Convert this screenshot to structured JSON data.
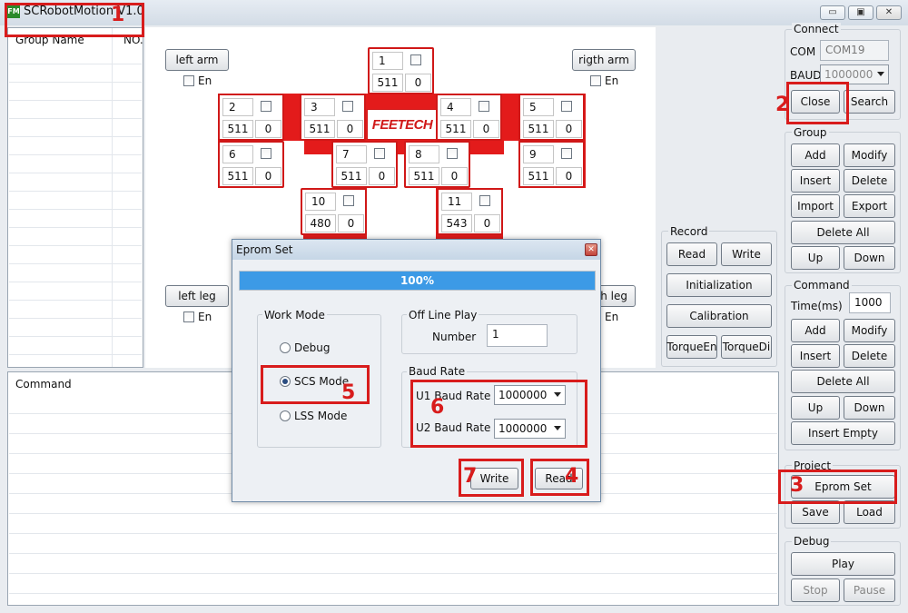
{
  "window": {
    "title": "SCRobotMotion V1.0",
    "icon_text": "FM",
    "controls": {
      "minimize": "▭",
      "restore": "▣",
      "close": "✕"
    }
  },
  "group_list": {
    "col_group_name": "Group Name",
    "col_no": "NO."
  },
  "robot": {
    "left_arm_label": "left arm",
    "right_arm_label": "rigth arm",
    "left_leg_label": "left leg",
    "right_leg_label": "h leg",
    "en_label": "En",
    "logo_text": "FEETECH",
    "servos": [
      {
        "id": "1",
        "position": "511",
        "speed": "0"
      },
      {
        "id": "2",
        "position": "511",
        "speed": "0"
      },
      {
        "id": "3",
        "position": "511",
        "speed": "0"
      },
      {
        "id": "4",
        "position": "511",
        "speed": "0"
      },
      {
        "id": "5",
        "position": "511",
        "speed": "0"
      },
      {
        "id": "6",
        "position": "511",
        "speed": "0"
      },
      {
        "id": "7",
        "position": "511",
        "speed": "0"
      },
      {
        "id": "8",
        "position": "511",
        "speed": "0"
      },
      {
        "id": "9",
        "position": "511",
        "speed": "0"
      },
      {
        "id": "10",
        "position": "480",
        "speed": "0"
      },
      {
        "id": "11",
        "position": "543",
        "speed": "0"
      }
    ]
  },
  "record": {
    "title": "Record",
    "read": "Read",
    "write": "Write",
    "initialization": "Initialization",
    "calibration": "Calibration",
    "torque_en": "TorqueEn",
    "torque_di": "TorqueDi"
  },
  "command_panel": {
    "header": "Command"
  },
  "connect": {
    "title": "Connect",
    "com_label": "COM",
    "com_value": "COM19",
    "baud_label": "BAUD",
    "baud_value": "1000000",
    "close": "Close",
    "search": "Search"
  },
  "group": {
    "title": "Group",
    "add": "Add",
    "modify": "Modify",
    "insert": "Insert",
    "delete": "Delete",
    "import": "Import",
    "export": "Export",
    "delete_all": "Delete All",
    "up": "Up",
    "down": "Down"
  },
  "command": {
    "title": "Command",
    "time_label": "Time(ms)",
    "time_value": "1000",
    "add": "Add",
    "modify": "Modify",
    "insert": "Insert",
    "delete": "Delete",
    "delete_all": "Delete All",
    "up": "Up",
    "down": "Down",
    "insert_empty": "Insert Empty"
  },
  "project": {
    "title": "Project",
    "eprom_set": "Eprom Set",
    "save": "Save",
    "load": "Load"
  },
  "debug": {
    "title": "Debug",
    "play": "Play",
    "stop": "Stop",
    "pause": "Pause"
  },
  "dialog": {
    "title": "Eprom Set",
    "progress_text": "100%",
    "progress_value": 1.0,
    "work_mode_title": "Work Mode",
    "mode_debug": "Debug",
    "mode_scs": "SCS Mode",
    "mode_lss": "LSS Mode",
    "selected_mode": "scs",
    "offline_title": "Off Line Play",
    "number_label": "Number",
    "number_value": "1",
    "baud_title": "Baud Rate",
    "u1_label": "U1 Baud Rate",
    "u1_value": "1000000",
    "u2_label": "U2 Baud Rate",
    "u2_value": "1000000",
    "write": "Write",
    "read": "Read"
  },
  "annotations": [
    "1",
    "2",
    "3",
    "4",
    "5",
    "6",
    "7"
  ],
  "colors": {
    "robot_red": "#e31b1b",
    "annotation_red": "#d81c1c",
    "progress_blue": "#3c9ae6"
  }
}
